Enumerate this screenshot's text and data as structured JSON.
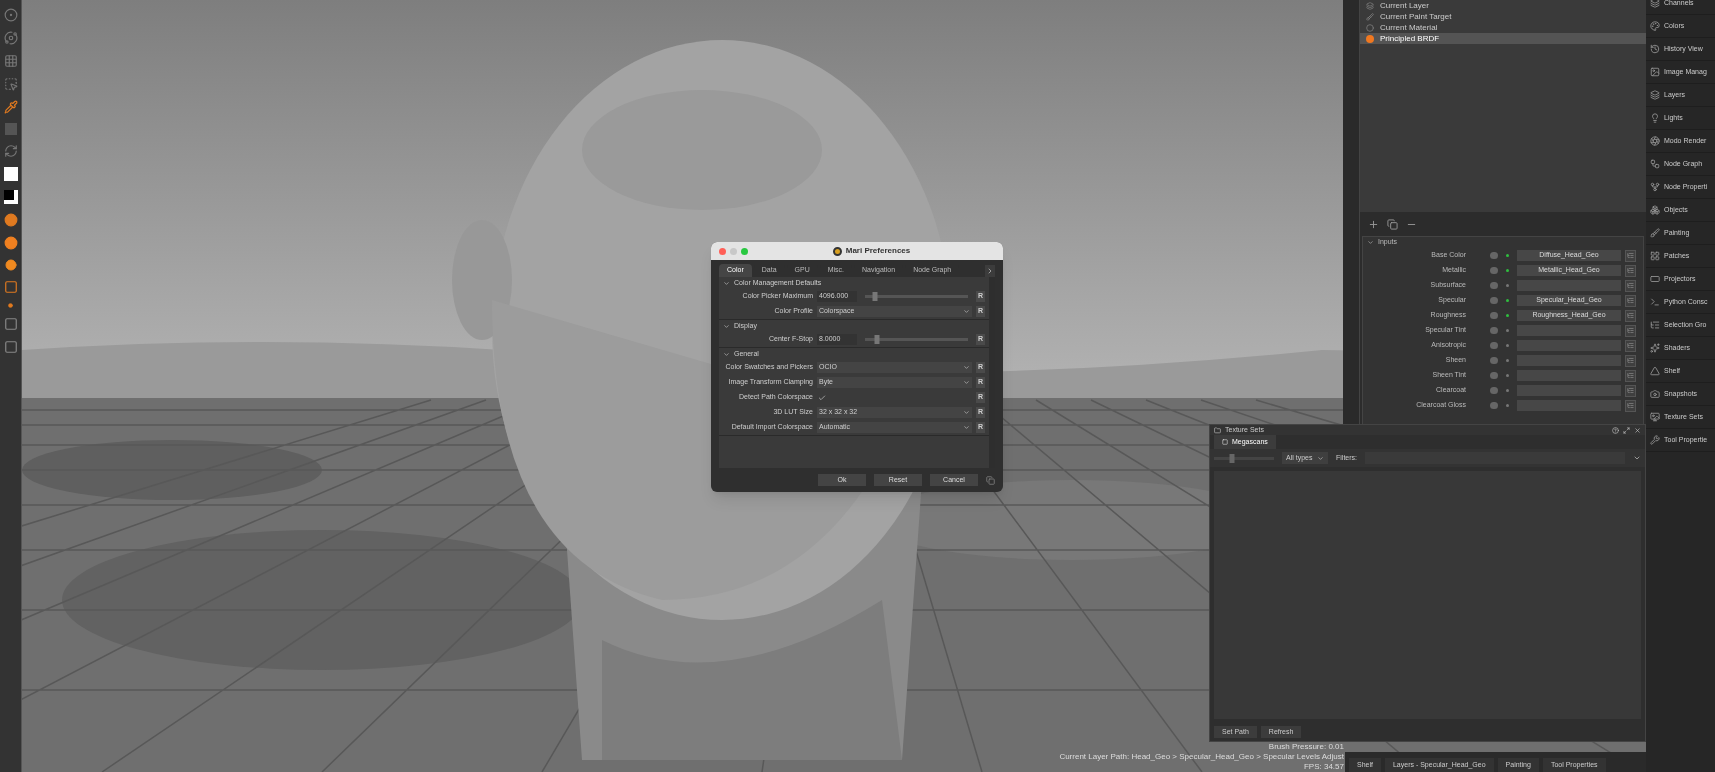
{
  "node_panel": {
    "items": [
      {
        "label": "Current Layer",
        "selected": false,
        "kind": "layer"
      },
      {
        "label": "Current Paint Target",
        "selected": false,
        "kind": "target"
      },
      {
        "label": "Current Material",
        "selected": false,
        "kind": "material"
      },
      {
        "label": "Principled BRDF",
        "selected": true,
        "kind": "shader"
      }
    ],
    "inputs": {
      "title": "Inputs",
      "expanded": true,
      "rows": [
        {
          "name": "Base Color",
          "connected": true,
          "value": "Diffuse_Head_Geo"
        },
        {
          "name": "Metallic",
          "connected": true,
          "value": "Metallic_Head_Geo"
        },
        {
          "name": "Subsurface",
          "connected": false
        },
        {
          "name": "Specular",
          "connected": true,
          "value": "Specular_Head_Geo"
        },
        {
          "name": "Roughness",
          "connected": true,
          "value": "Roughness_Head_Geo"
        },
        {
          "name": "Specular Tint",
          "connected": false
        },
        {
          "name": "Anisotropic",
          "connected": false
        },
        {
          "name": "Sheen",
          "connected": false
        },
        {
          "name": "Sheen Tint",
          "connected": false
        },
        {
          "name": "Clearcoat",
          "connected": false
        },
        {
          "name": "Clearcoat Gloss",
          "connected": false
        }
      ]
    }
  },
  "preferences": {
    "title": "Mari Preferences",
    "tabs": [
      {
        "label": "Color",
        "selected": true
      },
      {
        "label": "Data",
        "selected": false
      },
      {
        "label": "GPU",
        "selected": false
      },
      {
        "label": "Misc.",
        "selected": false
      },
      {
        "label": "Navigation",
        "selected": false
      },
      {
        "label": "Node Graph",
        "selected": false
      }
    ],
    "sections": [
      {
        "title": "Color Management Defaults",
        "expanded": true,
        "rows": [
          {
            "kind": "slider",
            "label": "Color Picker Maximum",
            "value": "4096.000",
            "level": 0.1,
            "reset": "R"
          },
          {
            "kind": "dropdown",
            "label": "Color Profile",
            "value": "Colorspace",
            "reset": "R"
          }
        ]
      },
      {
        "title": "Display",
        "expanded": true,
        "rows": [
          {
            "kind": "slider",
            "label": "Center F-Stop",
            "value": "8.0000",
            "level": 0.12,
            "reset": "R"
          }
        ]
      },
      {
        "title": "General",
        "expanded": true,
        "rows": [
          {
            "kind": "dropdown",
            "label": "Color Swatches and Pickers",
            "value": "OCIO",
            "reset": "R"
          },
          {
            "kind": "dropdown",
            "label": "Image Transform Clamping",
            "value": "Byte",
            "reset": "R"
          },
          {
            "kind": "checkbox",
            "label": "Detect Path Colorspace",
            "checked": true,
            "reset": "R"
          },
          {
            "kind": "dropdown",
            "label": "3D LUT Size",
            "value": "32 x 32 x 32",
            "reset": "R"
          },
          {
            "kind": "dropdown",
            "label": "Default Import Colorspace",
            "value": "Automatic",
            "reset": "R"
          }
        ]
      }
    ],
    "buttons": [
      "Ok",
      "Reset",
      "Cancel"
    ]
  },
  "texture_sets": {
    "title": "Texture Sets",
    "tabs": [
      {
        "label": "Megascans",
        "selected": true
      }
    ],
    "type_filter": "All types",
    "size_slider": {
      "level": 0.3
    },
    "filters_label": "Filters:",
    "buttons": [
      "Set Path",
      "Refresh"
    ]
  },
  "status": [
    "Brush Pressure: 0.01",
    "Current Layer Path: Head_Geo > Specular_Head_Geo > Specular Levels Adjust",
    "FPS: 34.57"
  ],
  "dock_tabs": [
    "Shelf",
    "Layers - Specular_Head_Geo",
    "Painting",
    "Tool Properties"
  ],
  "sidebar": [
    "Channels",
    "Colors",
    "History View",
    "Image Manag",
    "Layers",
    "Lights",
    "Modo Render",
    "Node Graph",
    "Node Properti",
    "Objects",
    "Painting",
    "Patches",
    "Projectors",
    "Python Consc",
    "Selection Gro",
    "Shaders",
    "Shelf",
    "Snapshots",
    "Texture Sets",
    "Tool Propertie"
  ]
}
